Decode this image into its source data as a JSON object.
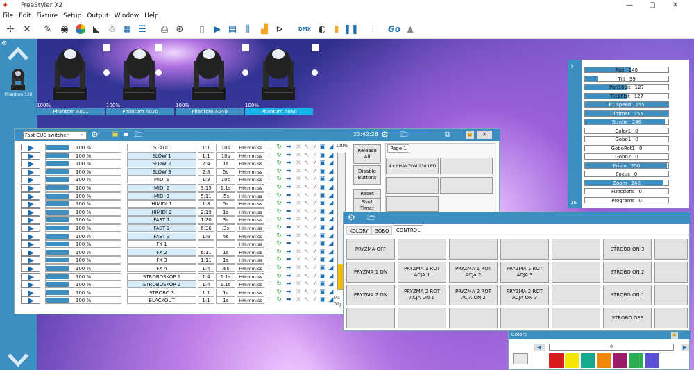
{
  "window": {
    "title": "FreeStyler X2",
    "minimize": "—",
    "maximize": "▢",
    "close": "✕"
  },
  "menu": [
    "File",
    "Edit",
    "Fixture",
    "Setup",
    "Output",
    "Window",
    "Help"
  ],
  "toolbar": {
    "dmx_badge": "DMX",
    "go_label": "Go"
  },
  "sidebar": {
    "fixture_label": "Phantom 130"
  },
  "fixtures": [
    {
      "pct": "100%",
      "name": "Phantom A001"
    },
    {
      "pct": "100%",
      "name": "Phantom A020"
    },
    {
      "pct": "100%",
      "name": "Phantom A040"
    },
    {
      "pct": "100%",
      "name": "Phantom A060"
    }
  ],
  "cue_window": {
    "selector": "Fast CUE switcher",
    "time": "23:42:28",
    "master_pct": "100%",
    "release_all": "Release All",
    "disable_buttons": "Disable Buttons",
    "reset": "Reset",
    "start_timer": "Start Timer",
    "page_tab": "Page 1",
    "fixture_btn": "4 x PHANTOM 130 LED",
    "side_label_1": "Ma",
    "side_label_2": "Trig",
    "rows": [
      {
        "pct": "100 %",
        "name": "STATIC",
        "a": "1:1",
        "b": "10s",
        "t": "HH:mm:ss",
        "sel": false
      },
      {
        "pct": "100 %",
        "name": "SLOW 1",
        "a": "1:1",
        "b": "10s",
        "t": "HH:mm:ss",
        "sel": true
      },
      {
        "pct": "100 %",
        "name": "SLOW 2",
        "a": "2:4",
        "b": "1s",
        "t": "HH:mm:ss",
        "sel": true
      },
      {
        "pct": "100 %",
        "name": "SLOW 3",
        "a": "2:8",
        "b": "5s",
        "t": "HH:mm:ss",
        "sel": true
      },
      {
        "pct": "100 %",
        "name": "MIDI 1",
        "a": "1:3",
        "b": "10s",
        "t": "HH:mm:ss",
        "sel": false
      },
      {
        "pct": "100 %",
        "name": "MIDI 2",
        "a": "3:15",
        "b": "1.1s",
        "t": "HH:mm:ss",
        "sel": true
      },
      {
        "pct": "100 %",
        "name": "MIDI 3",
        "a": "5:11",
        "b": ".5s",
        "t": "HH:mm:ss",
        "sel": true
      },
      {
        "pct": "100 %",
        "name": "HIMIDI 1",
        "a": "1:8",
        "b": "5s",
        "t": "HH:mm:ss",
        "sel": false
      },
      {
        "pct": "100 %",
        "name": "HIMIDI 2",
        "a": "2:19",
        "b": "1s",
        "t": "HH:mm:ss",
        "sel": true
      },
      {
        "pct": "100 %",
        "name": "FAST 1",
        "a": "1:20",
        "b": "3s",
        "t": "HH:mm:ss",
        "sel": true
      },
      {
        "pct": "100 %",
        "name": "FAST 2",
        "a": "6:36",
        "b": ".3s",
        "t": "HH:mm:ss",
        "sel": true
      },
      {
        "pct": "100 %",
        "name": "FAST 3",
        "a": "1:6",
        "b": "4s",
        "t": "HH:mm:ss",
        "sel": true
      },
      {
        "pct": "100 %",
        "name": "FX 1",
        "a": "",
        "b": "",
        "t": "HH:mm:ss",
        "sel": false
      },
      {
        "pct": "100 %",
        "name": "FX 2",
        "a": "6:11",
        "b": "1s",
        "t": "HH:mm:ss",
        "sel": true
      },
      {
        "pct": "100 %",
        "name": "FX 3",
        "a": "1:11",
        "b": "1s",
        "t": "HH:mm:ss",
        "sel": false
      },
      {
        "pct": "100 %",
        "name": "FX 4",
        "a": "1:4",
        "b": ".6s",
        "t": "HH:mm:ss",
        "sel": false
      },
      {
        "pct": "100 %",
        "name": "STROBOSKOP 1",
        "a": "1:4",
        "b": "1.1s",
        "t": "HH:mm:ss",
        "sel": false
      },
      {
        "pct": "100 %",
        "name": "STROBOSKOP 2",
        "a": "1:4",
        "b": "1.1s",
        "t": "HH:mm:ss",
        "sel": true
      },
      {
        "pct": "100 %",
        "name": "STROBO 3",
        "a": "1:1",
        "b": "1s",
        "t": "HH:mm:ss",
        "sel": false
      },
      {
        "pct": "100 %",
        "name": "BLACKOUT",
        "a": "1:1",
        "b": "1s",
        "t": "HH:mm:ss",
        "sel": false
      }
    ]
  },
  "control_window": {
    "tabs": [
      "KOLORY",
      "GOBO",
      "CONTROL"
    ],
    "buttons": [
      [
        "PRYZMA OFF",
        "",
        "",
        "",
        "",
        "STROBO ON 3"
      ],
      [
        "PRYZMA 1 ON",
        "PRYZMA 1 ROT ACJA 1",
        "PRYZMA 1 ROT ACJA 2",
        "PRYZMA 1 ROT ACJA 3",
        "",
        "STROBO ON 2"
      ],
      [
        "PRYZMA 2 ON",
        "PRYZMA 2 ROT ACJA ON 1",
        "PRYZMA 2 ROT ACJA ON 2",
        "PRYZMA 2 ROT ACJA ON 3",
        "",
        "STROBO ON 1"
      ],
      [
        "",
        "",
        "",
        "",
        "",
        "STROBO OFF"
      ]
    ]
  },
  "dmx_panel": {
    "page_num": "16",
    "channels": [
      {
        "label": "Pan",
        "value": "140",
        "level": 0.55
      },
      {
        "label": "Tilt",
        "value": "39",
        "level": 0.15
      },
      {
        "label": "Pan16bit",
        "value": "127",
        "level": 0.5
      },
      {
        "label": "Tilt16bit",
        "value": "127",
        "level": 0.5
      },
      {
        "label": "PT speed",
        "value": "255",
        "level": 1.0
      },
      {
        "label": "Dimmer",
        "value": "255",
        "level": 1.0
      },
      {
        "label": "Strobe",
        "value": "246",
        "level": 0.96
      },
      {
        "label": "Color1",
        "value": "0",
        "level": 0
      },
      {
        "label": "Gobo1",
        "value": "0",
        "level": 0
      },
      {
        "label": "GoboRot1",
        "value": "0",
        "level": 0
      },
      {
        "label": "Gobo2",
        "value": "0",
        "level": 0
      },
      {
        "label": "Prism",
        "value": "250",
        "level": 0.98
      },
      {
        "label": "Focus",
        "value": "0",
        "level": 0
      },
      {
        "label": "Zoom",
        "value": "240",
        "level": 0.94
      },
      {
        "label": "Functions",
        "value": "0",
        "level": 0
      },
      {
        "label": "Programs",
        "value": "0",
        "level": 0
      }
    ]
  },
  "colors_window": {
    "title": "Colors",
    "slider_value": "0",
    "swatches": [
      "#d81c1c",
      "#f2e600",
      "#18a88c",
      "#f0880c",
      "#9c1a6a",
      "#2eae52",
      "#5a50d8"
    ]
  }
}
